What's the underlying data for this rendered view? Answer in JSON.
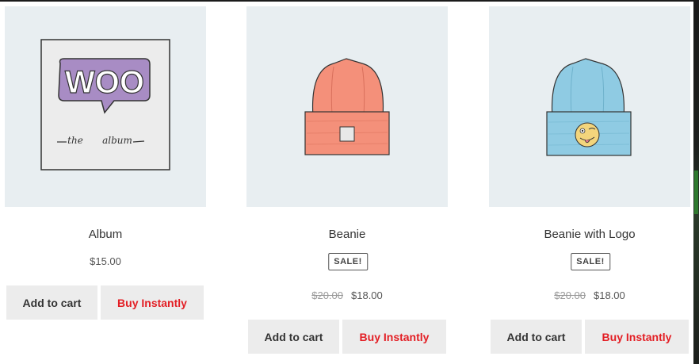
{
  "products": [
    {
      "title": "Album",
      "price": "$15.00",
      "image_icon": "woo-album-icon",
      "album_logo_text": "WOO",
      "album_caption_left": "the",
      "album_caption_right": "album",
      "add_to_cart_label": "Add to cart",
      "buy_label": "Buy Instantly"
    },
    {
      "title": "Beanie",
      "sale_badge": "SALE!",
      "old_price": "$20.00",
      "price": "$18.00",
      "image_icon": "orange-beanie-icon",
      "add_to_cart_label": "Add to cart",
      "buy_label": "Buy Instantly"
    },
    {
      "title": "Beanie with Logo",
      "sale_badge": "SALE!",
      "old_price": "$20.00",
      "price": "$18.00",
      "image_icon": "blue-beanie-logo-icon",
      "add_to_cart_label": "Add to cart",
      "buy_label": "Buy Instantly"
    }
  ],
  "colors": {
    "image_bg": "#e8eef1",
    "button_bg": "#ececec",
    "buy_text": "#e31e24",
    "woo_purple": "#a88cc4",
    "beanie_orange": "#f4907a",
    "beanie_blue": "#8fcbe3"
  }
}
